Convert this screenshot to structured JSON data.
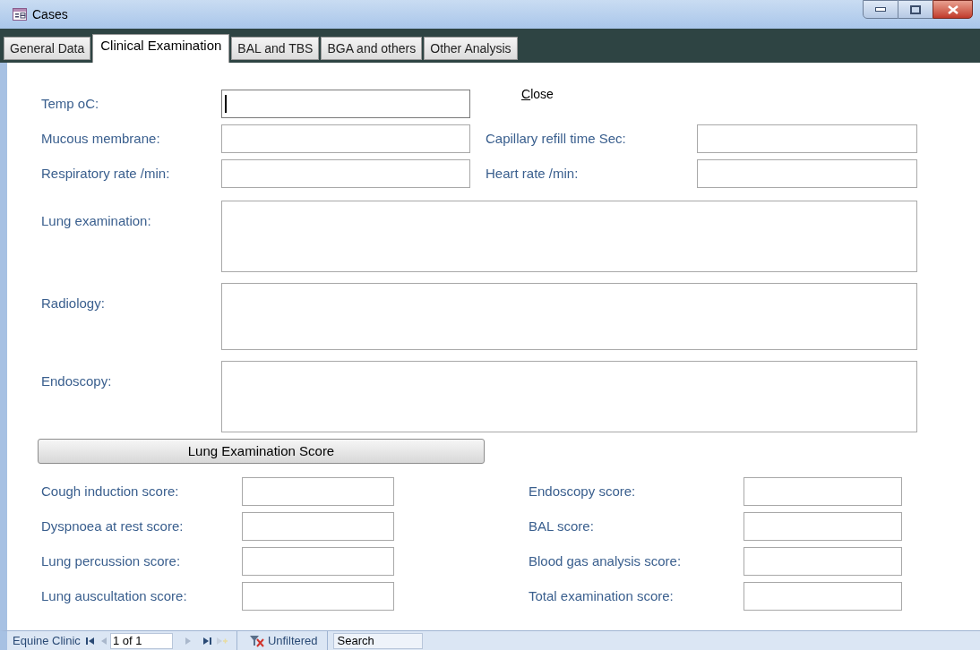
{
  "window": {
    "title": "Cases"
  },
  "tabs": [
    {
      "label": "General Data",
      "selected": false
    },
    {
      "label": "Clinical Examination",
      "selected": true
    },
    {
      "label": "BAL and TBS",
      "selected": false
    },
    {
      "label": "BGA and others",
      "selected": false
    },
    {
      "label": "Other Analysis",
      "selected": false
    }
  ],
  "close_button": "Close",
  "left_fields": [
    {
      "label": "Temp oC:",
      "focused": true
    },
    {
      "label": "Mucous membrane:",
      "focused": false
    },
    {
      "label": "Respiratory rate /min:",
      "focused": false
    }
  ],
  "right_fields": [
    {
      "label": "Capillary refill time Sec:"
    },
    {
      "label": "Heart rate /min:"
    }
  ],
  "note_fields": [
    {
      "label": "Lung examination:"
    },
    {
      "label": "Radiology:"
    },
    {
      "label": "Endoscopy:"
    }
  ],
  "score_button": "Lung Examination Score",
  "scores_left": [
    {
      "label": "Cough induction score:"
    },
    {
      "label": "Dyspnoea at rest score:"
    },
    {
      "label": "Lung percussion score:"
    },
    {
      "label": "Lung auscultation score:"
    }
  ],
  "scores_right": [
    {
      "label": "Endoscopy score:"
    },
    {
      "label": "BAL score:"
    },
    {
      "label": "Blood gas analysis score:"
    },
    {
      "label": "Total examination score:"
    }
  ],
  "status_bar": {
    "label": "Equine Clinic",
    "record": "1 of 1",
    "filter": "Unfiltered",
    "search_placeholder": "Search"
  }
}
